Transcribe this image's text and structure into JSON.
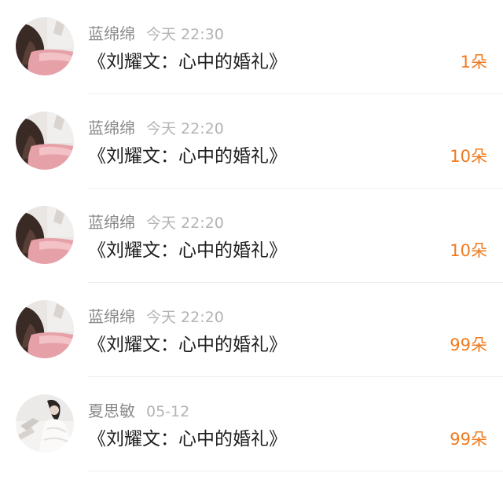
{
  "messages": [
    {
      "user": "蓝绵绵",
      "time": "今天 22:30",
      "title": "《刘耀文：心中的婚礼》",
      "count": "1朵",
      "avatar": "avatar-photo-hair"
    },
    {
      "user": "蓝绵绵",
      "time": "今天 22:20",
      "title": "《刘耀文：心中的婚礼》",
      "count": "10朵",
      "avatar": "avatar-photo-hair"
    },
    {
      "user": "蓝绵绵",
      "time": "今天 22:20",
      "title": "《刘耀文：心中的婚礼》",
      "count": "10朵",
      "avatar": "avatar-photo-hair"
    },
    {
      "user": "蓝绵绵",
      "time": "今天 22:20",
      "title": "《刘耀文：心中的婚礼》",
      "count": "99朵",
      "avatar": "avatar-photo-hair"
    },
    {
      "user": "夏思敏",
      "time": "05-12",
      "title": "《刘耀文：心中的婚礼》",
      "count": "99朵",
      "avatar": "avatar-photo-dress"
    }
  ],
  "colors": {
    "count_accent": "#f07a1e",
    "username": "#8a8a8a",
    "time": "#b3b3b3",
    "title": "#1f1f1f"
  }
}
